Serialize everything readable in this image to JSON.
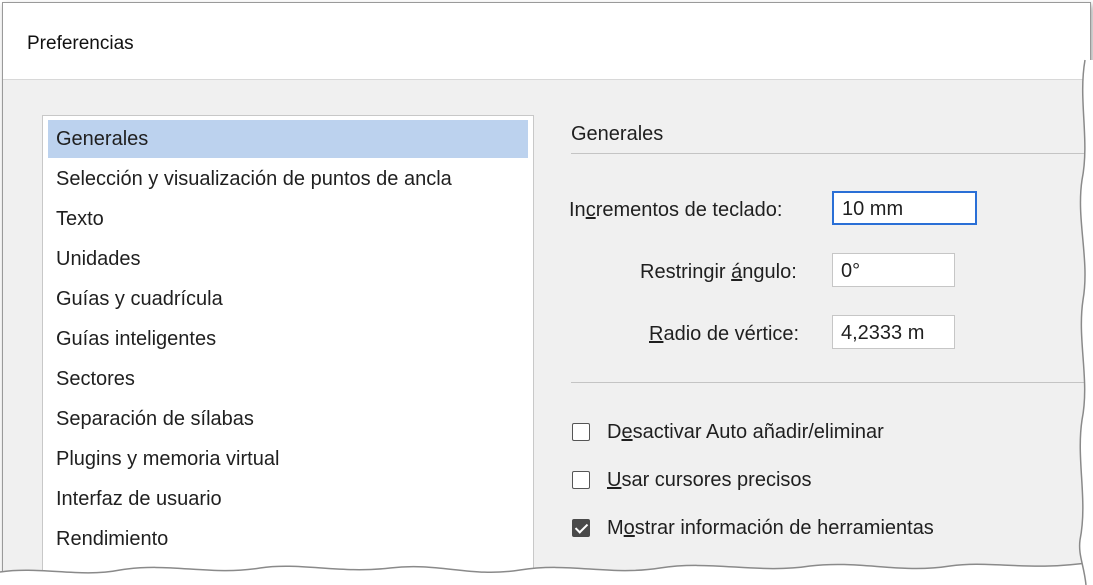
{
  "window": {
    "title": "Preferencias"
  },
  "categories": [
    {
      "label": "Generales",
      "selected": true
    },
    {
      "label": "Selección y visualización de puntos de ancla"
    },
    {
      "label": "Texto"
    },
    {
      "label": "Unidades"
    },
    {
      "label": "Guías y cuadrícula"
    },
    {
      "label": "Guías inteligentes"
    },
    {
      "label": "Sectores"
    },
    {
      "label": "Separación de sílabas"
    },
    {
      "label": "Plugins y memoria virtual"
    },
    {
      "label": "Interfaz de usuario"
    },
    {
      "label": "Rendimiento"
    }
  ],
  "panel": {
    "section_title": "Generales",
    "keyboard_increment": {
      "label_pre": "In",
      "label_u": "c",
      "label_post": "rementos de teclado:",
      "value": "10 mm"
    },
    "constrain_angle": {
      "label_pre": "Restringir ",
      "label_u": "á",
      "label_post": "ngulo:",
      "value": "0°"
    },
    "corner_radius": {
      "label_pre": "",
      "label_u": "R",
      "label_post": "adio de vértice:",
      "value": "4,2333 m"
    },
    "checkboxes": [
      {
        "label_pre": "D",
        "label_u": "e",
        "label_post": "sactivar Auto añadir/eliminar",
        "checked": false
      },
      {
        "label_pre": "",
        "label_u": "U",
        "label_post": "sar cursores precisos",
        "checked": false
      },
      {
        "label_pre": "M",
        "label_u": "o",
        "label_post": "strar información de herramientas",
        "checked": true
      }
    ]
  },
  "colors": {
    "selection": "#bcd2ee",
    "focus_border": "#2a6fd6",
    "dialog_bg": "#f0f0f0"
  }
}
